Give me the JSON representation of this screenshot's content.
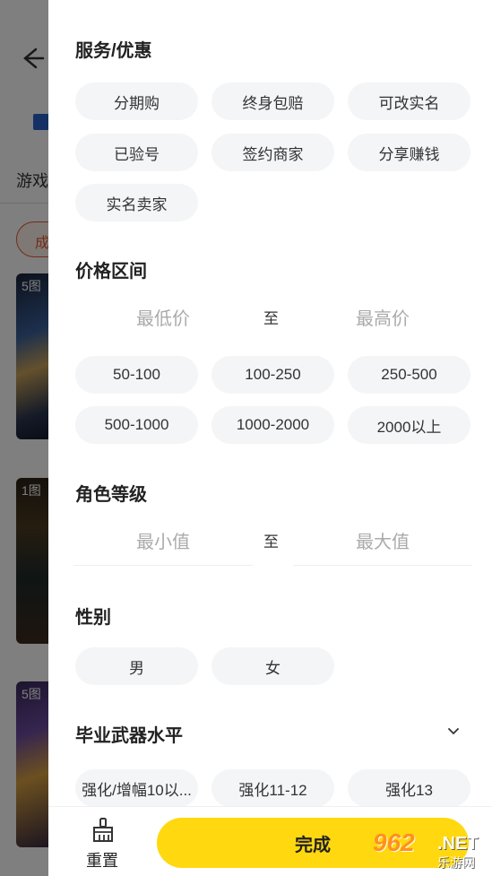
{
  "background": {
    "tab_text": "游戏",
    "chip_text": "成",
    "thumbs": [
      "5图",
      "1图",
      "5图"
    ]
  },
  "sections": {
    "services": {
      "title": "服务/优惠",
      "options": [
        "分期购",
        "终身包赔",
        "可改实名",
        "已验号",
        "签约商家",
        "分享赚钱",
        "实名卖家"
      ]
    },
    "price": {
      "title": "价格区间",
      "min_placeholder": "最低价",
      "separator": "至",
      "max_placeholder": "最高价",
      "options": [
        "50-100",
        "100-250",
        "250-500",
        "500-1000",
        "1000-2000",
        "2000以上"
      ]
    },
    "level": {
      "title": "角色等级",
      "min_placeholder": "最小值",
      "separator": "至",
      "max_placeholder": "最大值"
    },
    "gender": {
      "title": "性别",
      "options": [
        "男",
        "女"
      ]
    },
    "weapon": {
      "title": "毕业武器水平",
      "options": [
        "强化/增幅10以...",
        "强化11-12",
        "强化13"
      ]
    }
  },
  "bottom": {
    "reset_label": "重置",
    "done_label": "完成"
  },
  "watermark": {
    "number": "962",
    "net": ".NET",
    "cn": "乐游网"
  },
  "colors": {
    "accent": "#ffd80f",
    "chip_bg": "#f4f5f7",
    "overlay": "rgba(0,0,0,0.5)"
  }
}
